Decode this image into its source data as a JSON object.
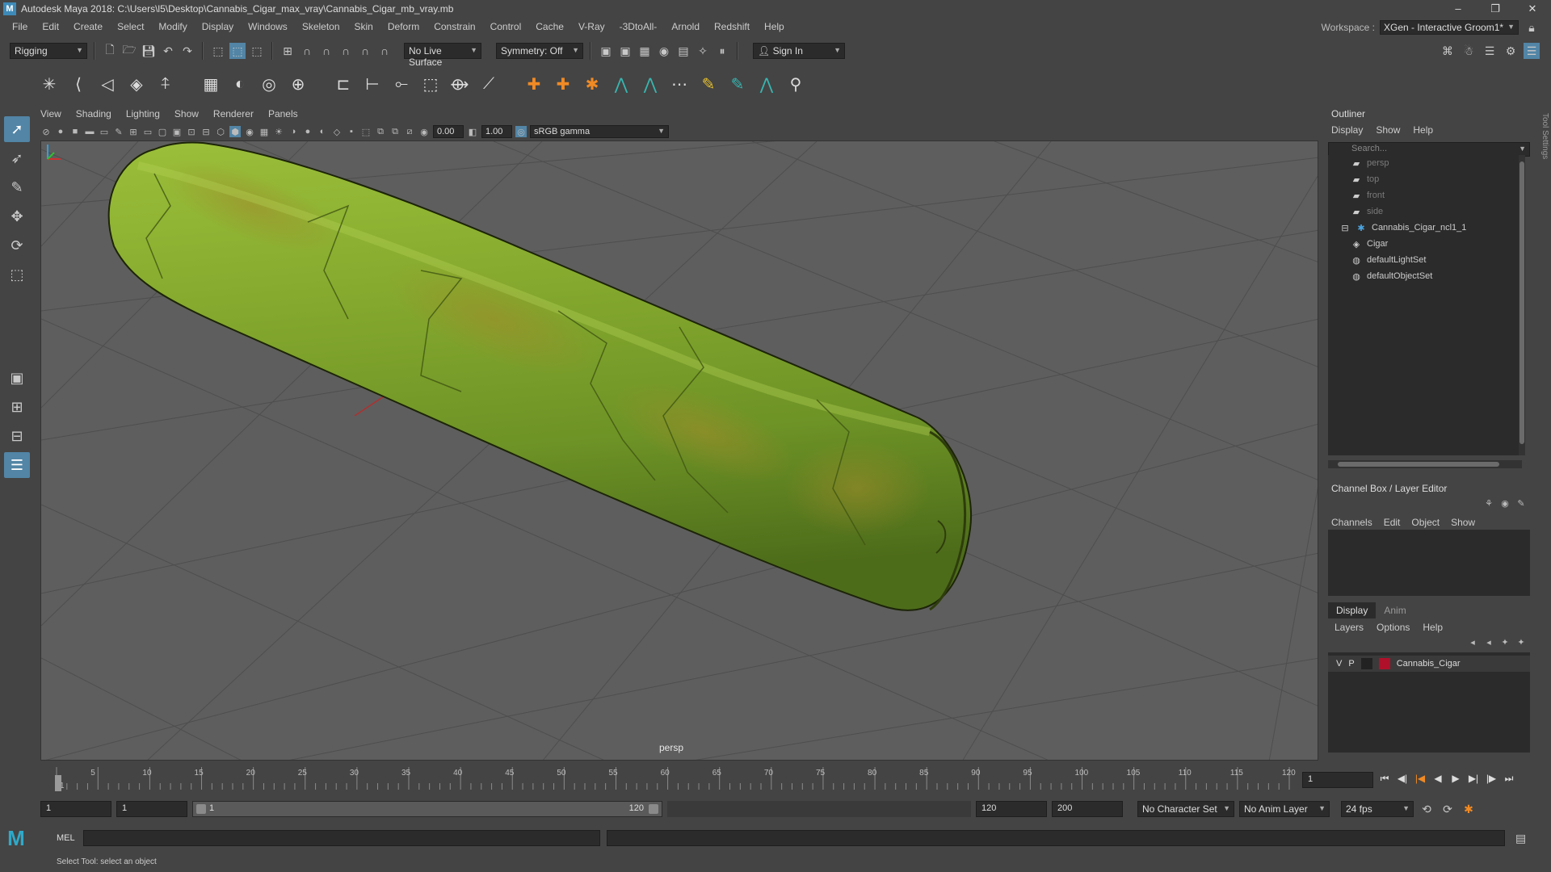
{
  "titlebar": {
    "title": "Autodesk Maya 2018: C:\\Users\\l5\\Desktop\\Cannabis_Cigar_max_vray\\Cannabis_Cigar_mb_vray.mb",
    "minimize": "–",
    "maximize": "❐",
    "close": "✕"
  },
  "menubar": {
    "items": [
      "File",
      "Edit",
      "Create",
      "Select",
      "Modify",
      "Display",
      "Windows",
      "Skeleton",
      "Skin",
      "Deform",
      "Constrain",
      "Control",
      "Cache",
      "V-Ray",
      "-3DtoAll-",
      "Arnold",
      "Redshift",
      "Help"
    ],
    "workspace_label": "Workspace :",
    "workspace_value": "XGen - Interactive Groom1*"
  },
  "statusline": {
    "menuset": "Rigging",
    "live_surface": "No Live Surface",
    "symmetry": "Symmetry: Off",
    "sign_in": "Sign In"
  },
  "viewport": {
    "menus": [
      "View",
      "Shading",
      "Lighting",
      "Show",
      "Renderer",
      "Panels"
    ],
    "exposure": "0.00",
    "gamma_value": "1.00",
    "color_space": "sRGB gamma",
    "camera_label": "persp"
  },
  "outliner": {
    "title": "Outliner",
    "menus": [
      "Display",
      "Show",
      "Help"
    ],
    "search_placeholder": "Search...",
    "items": [
      {
        "label": "persp",
        "icon": "camera-icon",
        "dim": true
      },
      {
        "label": "top",
        "icon": "camera-icon",
        "dim": true
      },
      {
        "label": "front",
        "icon": "camera-icon",
        "dim": true
      },
      {
        "label": "side",
        "icon": "camera-icon",
        "dim": true
      },
      {
        "label": "Cannabis_Cigar_ncl1_1",
        "icon": "group-icon",
        "dim": false
      },
      {
        "label": "Cigar",
        "icon": "mesh-icon",
        "dim": false
      },
      {
        "label": "defaultLightSet",
        "icon": "set-icon",
        "dim": false
      },
      {
        "label": "defaultObjectSet",
        "icon": "set-icon",
        "dim": false
      }
    ]
  },
  "channelbox": {
    "title": "Channel Box / Layer Editor",
    "menus": [
      "Channels",
      "Edit",
      "Object",
      "Show"
    ]
  },
  "layer_editor": {
    "tabs": [
      "Display",
      "Anim"
    ],
    "menus": [
      "Layers",
      "Options",
      "Help"
    ],
    "layer": {
      "v": "V",
      "p": "P",
      "name": "Cannabis_Cigar",
      "color": "#b0102a"
    }
  },
  "timeline": {
    "ticks": [
      "1",
      "5",
      "10",
      "15",
      "20",
      "25",
      "30",
      "35",
      "40",
      "45",
      "50",
      "55",
      "60",
      "65",
      "70",
      "75",
      "80",
      "85",
      "90",
      "95",
      "100",
      "105",
      "110",
      "115",
      "120"
    ],
    "current_frame": "1"
  },
  "range": {
    "start": "1",
    "playback_start": "1",
    "slider_start": "1",
    "slider_end": "120",
    "playback_end": "120",
    "end": "200",
    "character_set": "No Character Set",
    "anim_layer": "No Anim Layer",
    "fps": "24 fps"
  },
  "commandline": {
    "label": "MEL",
    "help": "Select Tool: select an object"
  },
  "side_tab": "Tool Settings",
  "colors": {
    "accent": "#5285a6",
    "viewport_bg": "#5e5e5e",
    "cigar_green": "#7fa62c"
  }
}
